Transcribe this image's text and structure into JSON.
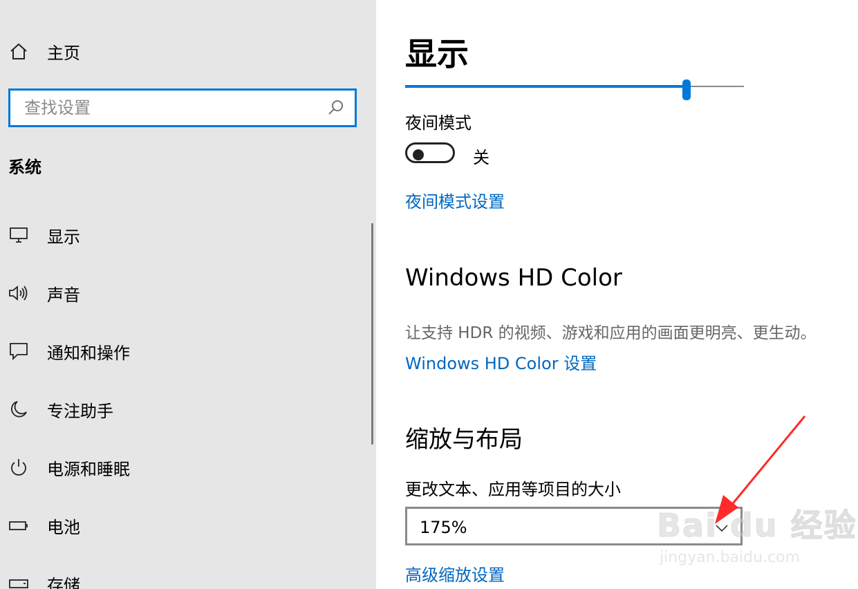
{
  "sidebar": {
    "home_label": "主页",
    "search_placeholder": "查找设置",
    "section_title": "系统",
    "items": [
      {
        "label": "显示",
        "icon": "monitor-icon"
      },
      {
        "label": "声音",
        "icon": "speaker-icon"
      },
      {
        "label": "通知和操作",
        "icon": "notification-icon"
      },
      {
        "label": "专注助手",
        "icon": "moon-icon"
      },
      {
        "label": "电源和睡眠",
        "icon": "power-icon"
      },
      {
        "label": "电池",
        "icon": "battery-icon"
      },
      {
        "label": "存储",
        "icon": "storage-icon"
      }
    ]
  },
  "main": {
    "page_title": "显示",
    "brightness_level": 0.83,
    "night_mode": {
      "label": "夜间模式",
      "state": "关",
      "settings_link": "夜间模式设置"
    },
    "hd_color": {
      "title": "Windows HD Color",
      "description": "让支持 HDR 的视频、游戏和应用的画面更明亮、更生动。",
      "link": "Windows HD Color 设置"
    },
    "scale": {
      "title": "缩放与布局",
      "label": "更改文本、应用等项目的大小",
      "value": "175%",
      "advanced_link": "高级缩放设置"
    }
  },
  "watermark": {
    "line1": "Bai du 经验",
    "line2": "jingyan.baidu.com"
  },
  "colors": {
    "accent": "#0078d7",
    "link": "#0067c0",
    "sidebar_bg": "#e6e6e6",
    "annotation_arrow": "#ff2a2a"
  }
}
